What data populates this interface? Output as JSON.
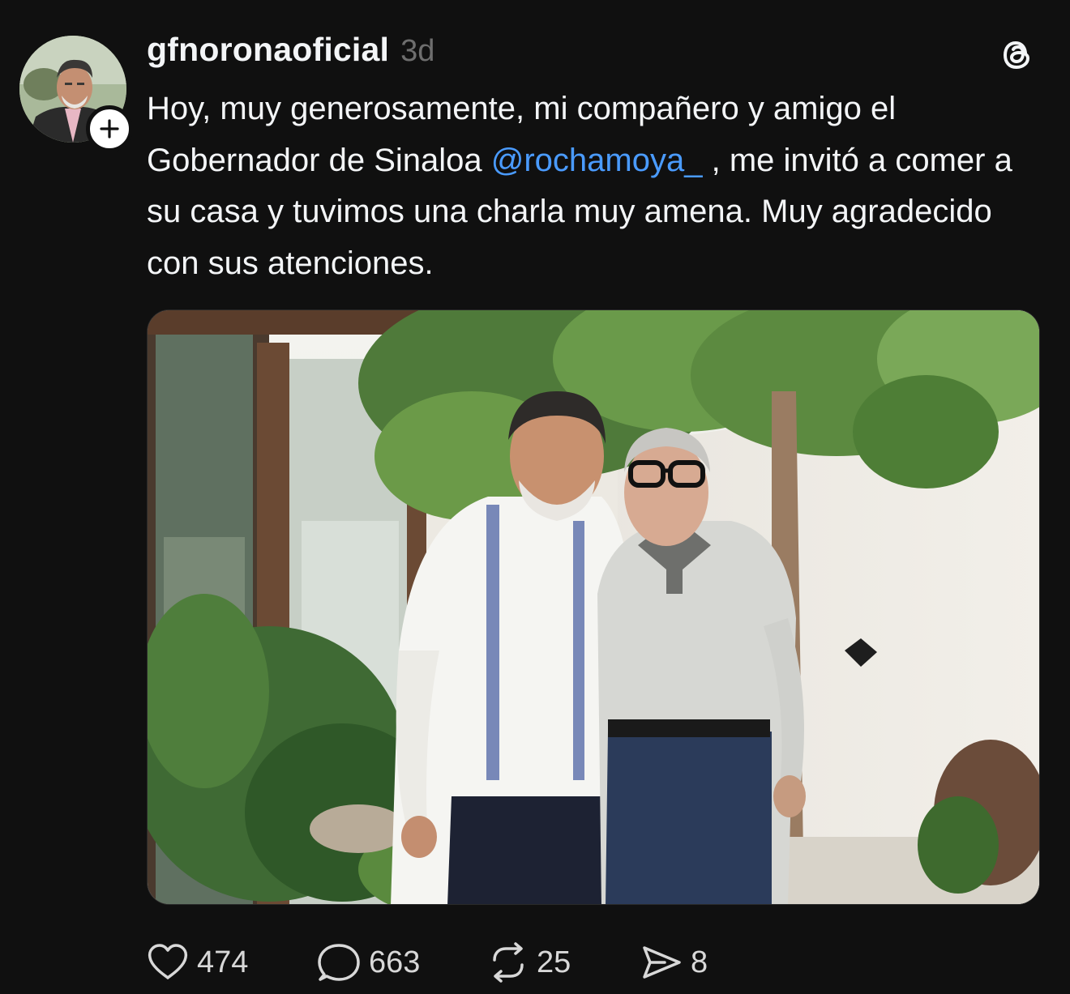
{
  "post": {
    "username": "gfnoronaoficial",
    "time": "3d",
    "text_before": "Hoy, muy generosamente, mi compañero y amigo el Gobernador de Sinaloa ",
    "mention": "@rochamoya_",
    "text_after": " , me invitó a comer a su casa y tuvimos una charla muy amena. Muy agradecido con sus atenciones."
  },
  "actions": {
    "likes": "474",
    "replies": "663",
    "reposts": "25",
    "shares": "8"
  },
  "icons": {
    "avatar": "profile-photo",
    "follow": "plus-icon",
    "app": "threads-logo-icon",
    "like": "heart-icon",
    "reply": "comment-bubble-icon",
    "repost": "repost-icon",
    "share": "send-icon"
  },
  "colors": {
    "background": "#101010",
    "text": "#f3f5f7",
    "mention": "#4a9bff",
    "timestamp": "#6e6e6e"
  }
}
